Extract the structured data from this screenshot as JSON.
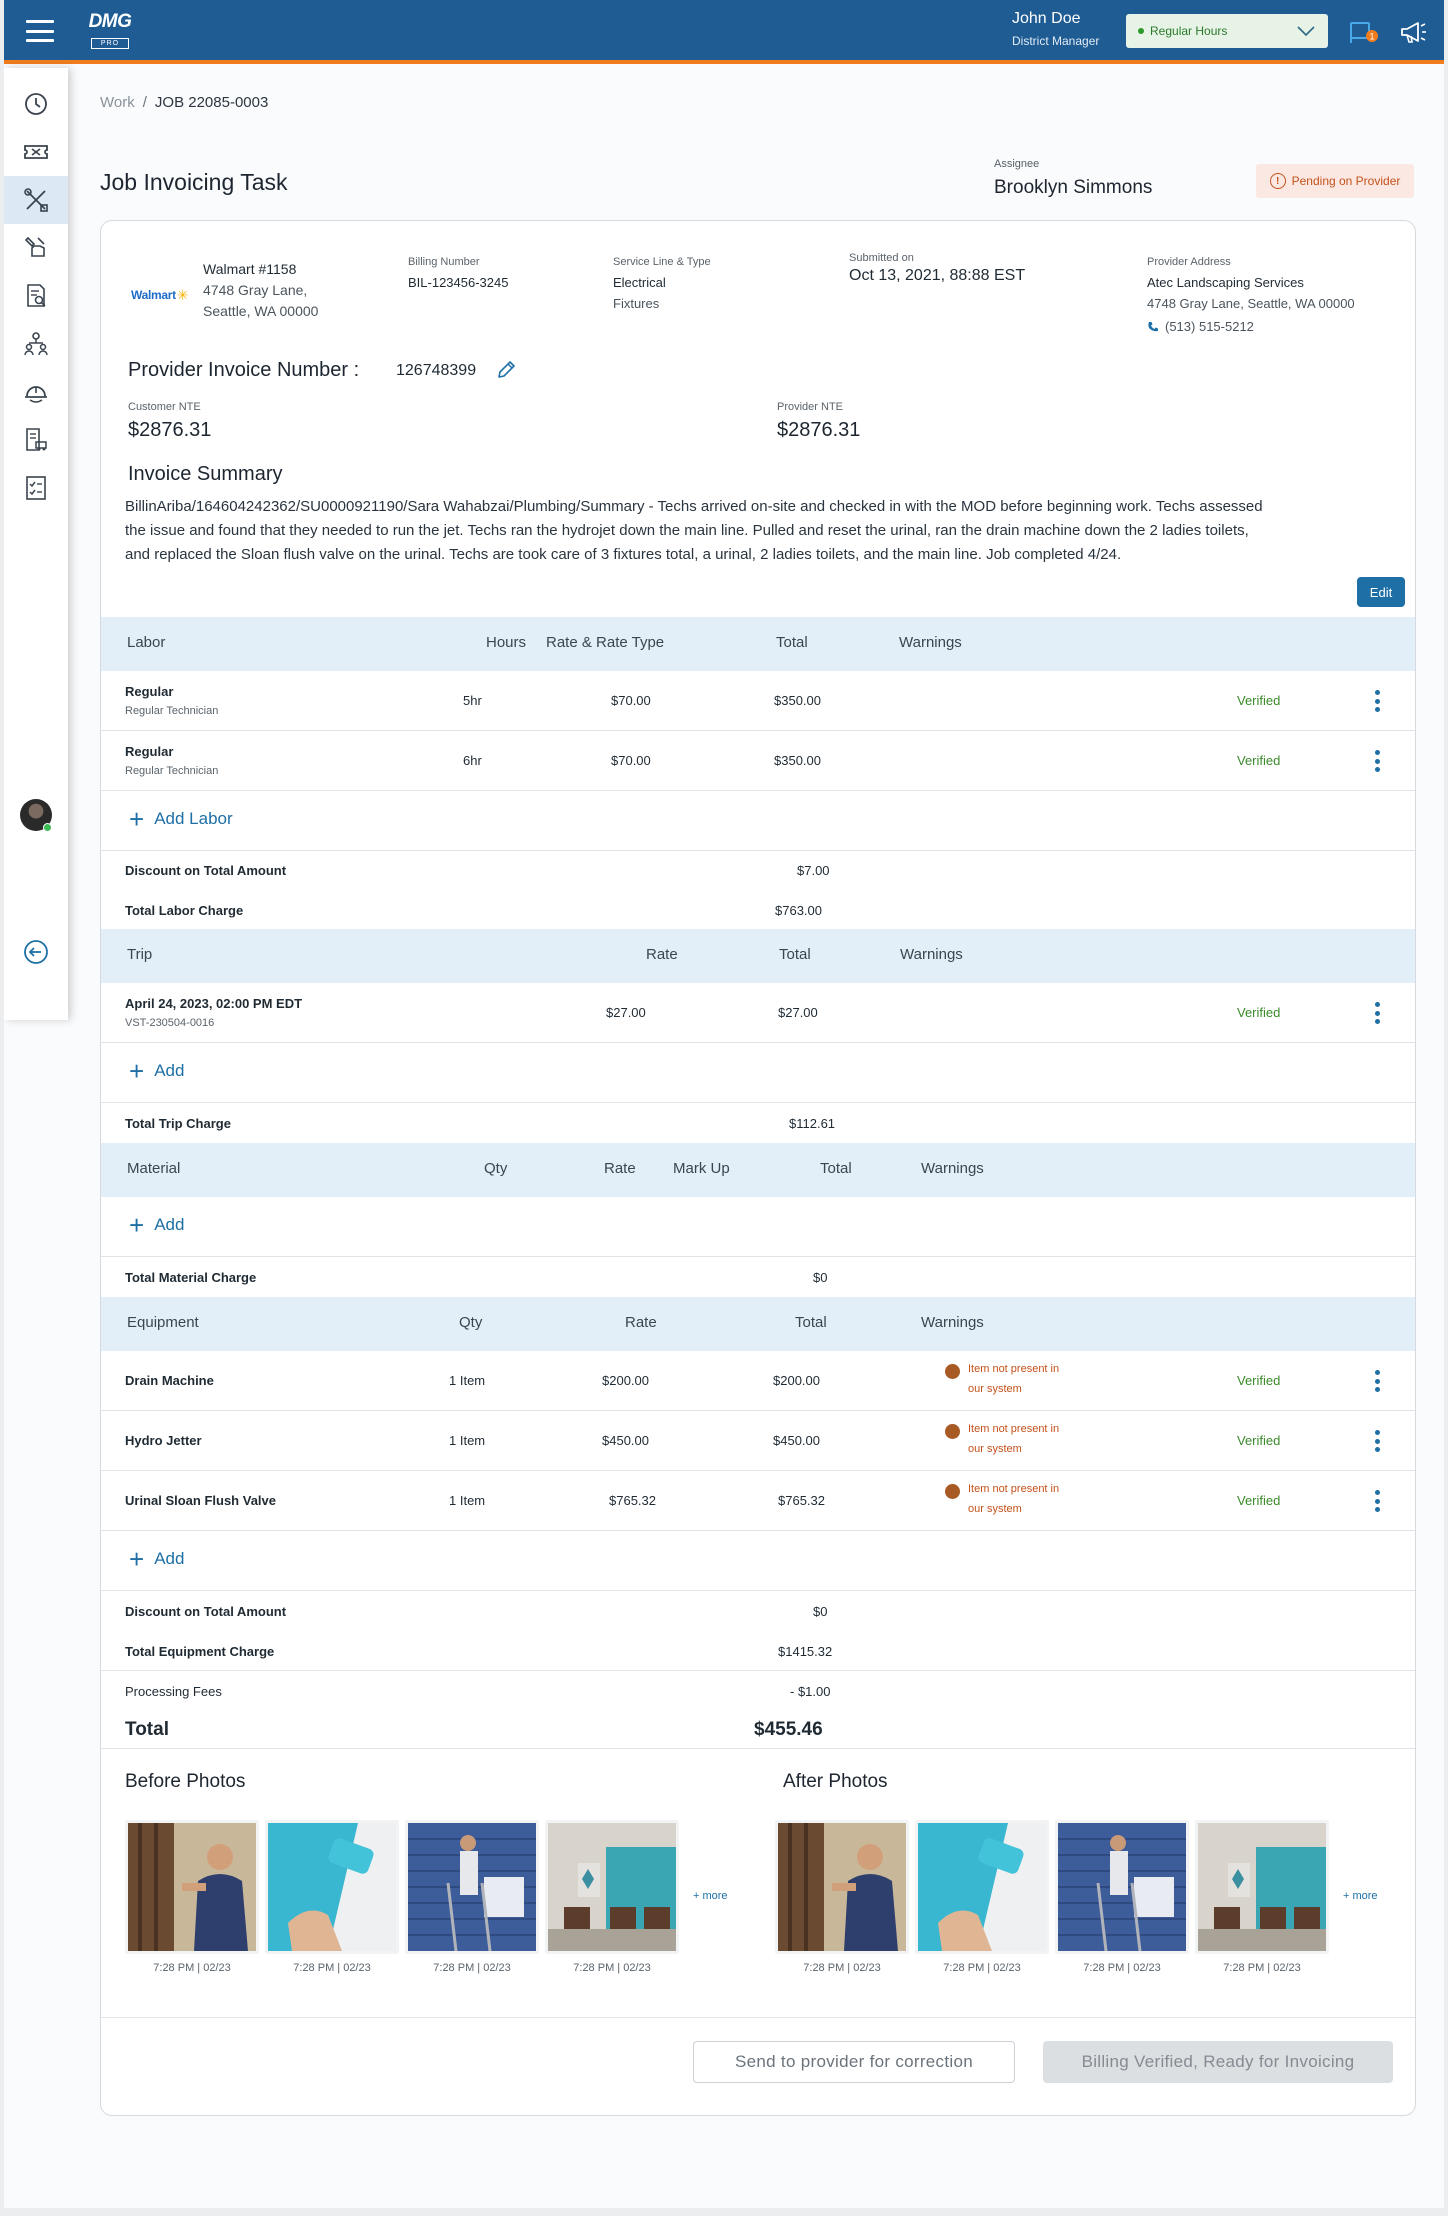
{
  "topbar": {
    "logo_main": "DMG",
    "logo_sub": "PRO",
    "user_name": "John Doe",
    "user_role": "District Manager",
    "status_value": "Regular Hours",
    "notification_count": "1"
  },
  "breadcrumb": {
    "root": "Work",
    "separator": "/",
    "current": "JOB 22085-0003"
  },
  "header": {
    "title": "Job Invoicing Task",
    "assignee_label": "Assignee",
    "assignee_name": "Brooklyn Simmons",
    "status_badge": "Pending on Provider"
  },
  "job": {
    "customer_logo": "Walmart",
    "customer_name": "Walmart #1158",
    "customer_address1": "4748 Gray Lane,",
    "customer_address2": "Seattle, WA 00000",
    "billing_label": "Billing Number",
    "billing_value": "BIL-123456-3245",
    "service_label": "Service Line & Type",
    "service_line": "Electrical",
    "service_type": "Fixtures",
    "submitted_label": "Submitted on",
    "submitted_value": "Oct 13, 2021, 88:88 EST",
    "provider_label": "Provider Address",
    "provider_name": "Atec Landscaping Services",
    "provider_address": "4748 Gray Lane, Seattle, WA 00000",
    "provider_phone": "(513) 515-5212"
  },
  "invoice": {
    "number_label": "Provider Invoice Number :",
    "number_value": "126748399",
    "customer_nte_label": "Customer NTE",
    "customer_nte_value": "$2876.31",
    "provider_nte_label": "Provider NTE",
    "provider_nte_value": "$2876.31",
    "summary_title": "Invoice Summary",
    "summary_line1": "BillinAriba/164604242362/SU0000921190/Sara Wahabzai/Plumbing/Summary - Techs arrived on-site and checked in with the MOD before beginning work. Techs assessed",
    "summary_line2": "the issue and found that they needed to run the jet. Techs ran the hydrojet down the main line. Pulled and reset the urinal, ran the drain machine down the 2 ladies toilets,",
    "summary_line3": "and replaced the Sloan flush valve on the urinal. Techs are took care of 3 fixtures total, a urinal, 2 ladies toilets, and the main line. Job completed 4/24.",
    "edit_label": "Edit"
  },
  "labor": {
    "headers": {
      "labor": "Labor",
      "hours": "Hours",
      "rate": "Rate & Rate Type",
      "total": "Total",
      "warnings": "Warnings"
    },
    "rows": [
      {
        "name": "Regular",
        "type": "Regular Technician",
        "hours": "5hr",
        "rate": "$70.00",
        "total": "$350.00",
        "status": "Verified"
      },
      {
        "name": "Regular",
        "type": "Regular Technician",
        "hours": "6hr",
        "rate": "$70.00",
        "total": "$350.00",
        "status": "Verified"
      }
    ],
    "add_label": "Add Labor",
    "discount_label": "Discount on Total Amount",
    "discount_value": "$7.00",
    "total_label": "Total Labor Charge",
    "total_value": "$763.00"
  },
  "trip": {
    "headers": {
      "trip": "Trip",
      "rate": "Rate",
      "total": "Total",
      "warnings": "Warnings"
    },
    "rows": [
      {
        "date": "April 24, 2023, 02:00 PM EDT",
        "id": "VST-230504-0016",
        "rate": "$27.00",
        "total": "$27.00",
        "status": "Verified"
      }
    ],
    "add_label": "Add",
    "total_label": "Total Trip Charge",
    "total_value": "$112.61"
  },
  "material": {
    "headers": {
      "material": "Material",
      "qty": "Qty",
      "rate": "Rate",
      "markup": "Mark Up",
      "total": "Total",
      "warnings": "Warnings"
    },
    "add_label": "Add",
    "total_label": "Total Material Charge",
    "total_value": "$0"
  },
  "equipment": {
    "headers": {
      "equipment": "Equipment",
      "qty": "Qty",
      "rate": "Rate",
      "total": "Total",
      "warnings": "Warnings"
    },
    "rows": [
      {
        "name": "Drain Machine",
        "qty": "1 Item",
        "rate": "$200.00",
        "total": "$200.00",
        "warning1": "Item not present in",
        "warning2": "our system",
        "status": "Verified"
      },
      {
        "name": "Hydro Jetter",
        "qty": "1 Item",
        "rate": "$450.00",
        "total": "$450.00",
        "warning1": "Item not present in",
        "warning2": "our system",
        "status": "Verified"
      },
      {
        "name": "Urinal Sloan Flush Valve",
        "qty": "1 Item",
        "rate": "$765.32",
        "total": "$765.32",
        "warning1": "Item not present in",
        "warning2": "our system",
        "status": "Verified"
      }
    ],
    "add_label": "Add",
    "discount_label": "Discount on Total Amount",
    "discount_value": "$0",
    "total_label": "Total Equipment Charge",
    "total_value": "$1415.32"
  },
  "summary": {
    "fees_label": "Processing Fees",
    "fees_value": "- $1.00",
    "grand_label": "Total",
    "grand_value": "$455.46"
  },
  "photos": {
    "before_title": "Before Photos",
    "after_title": "After Photos",
    "captions": [
      "7:28 PM | 02/23",
      "7:28 PM | 02/23",
      "7:28 PM | 02/23",
      "7:28 PM | 02/23"
    ],
    "more_label": "+ more"
  },
  "actions": {
    "correction_label": "Send to provider for correction",
    "verify_label": "Billing Verified, Ready for Invoicing"
  },
  "colors": {
    "brand": "#1f5c94",
    "accent": "#f07c1e",
    "link": "#1d6fa5",
    "verified": "#3a8a2b",
    "warning": "#c4521b"
  }
}
